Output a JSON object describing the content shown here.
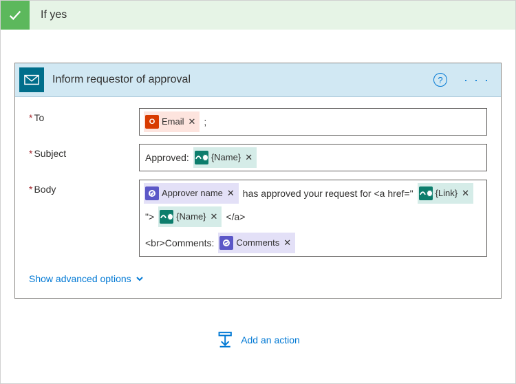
{
  "if_yes": {
    "title": "If yes"
  },
  "action": {
    "title": "Inform requestor of approval",
    "help": "?",
    "more": "· · ·"
  },
  "labels": {
    "to": "To",
    "subject": "Subject",
    "body": "Body"
  },
  "to": {
    "tokens": [
      {
        "kind": "office",
        "text": "Email"
      }
    ],
    "trail": ";"
  },
  "subject": {
    "lead": "Approved:",
    "tokens": [
      {
        "kind": "teal",
        "text": "{Name}"
      }
    ]
  },
  "body": {
    "parts": [
      {
        "type": "token",
        "kind": "purple",
        "text": "Approver name"
      },
      {
        "type": "text",
        "text": "has approved your request for <a href=\""
      },
      {
        "type": "token",
        "kind": "teal",
        "text": "{Link}"
      },
      {
        "type": "text",
        "text": "\">"
      },
      {
        "type": "token",
        "kind": "teal",
        "text": "{Name}"
      },
      {
        "type": "text",
        "text": "</a>"
      },
      {
        "type": "break"
      },
      {
        "type": "text",
        "text": "<br>Comments:"
      },
      {
        "type": "token",
        "kind": "purple",
        "text": "Comments"
      }
    ]
  },
  "advanced": {
    "label": "Show advanced options"
  },
  "add_action": {
    "label": "Add an action"
  }
}
